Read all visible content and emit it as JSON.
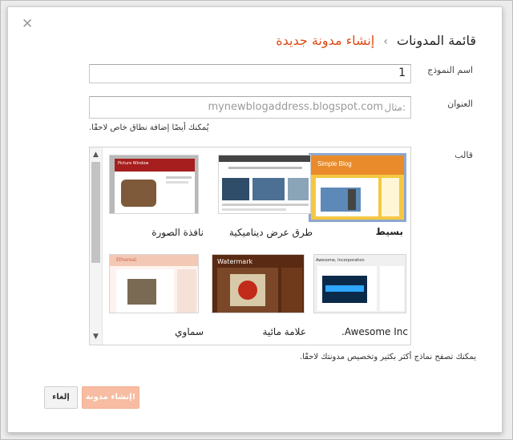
{
  "dialog": {
    "close_glyph": "✕",
    "breadcrumb": {
      "parent": "قائمة المدونات",
      "separator": "›",
      "current": "إنشاء مدونة جديدة"
    }
  },
  "form": {
    "title_label": "اسم النموذج",
    "title_value": "1",
    "address_label": "العنوان",
    "address_prefix": "مثال:",
    "address_placeholder": "mynewblogaddress.blogspot.com",
    "address_hint": "يُمكنك أيضًا إضافة نطاق خاص لاحقًا.",
    "template_label": "قالب"
  },
  "templates": [
    {
      "name": "بسيط",
      "selected": true
    },
    {
      "name": "طرق عرض ديناميكية",
      "selected": false
    },
    {
      "name": "نافذة الصورة",
      "selected": false
    },
    {
      "name": "Awesome Inc.",
      "selected": false
    },
    {
      "name": "علامة مائية",
      "selected": false
    },
    {
      "name": "سماوي",
      "selected": false
    }
  ],
  "thumbnails": {
    "simple_title": "Simple Blog",
    "picture_window_title": "Picture Window",
    "watermark_title": "Watermark",
    "awesome_title": "Awesome, Incorporation",
    "ethereal_title": "Ethereal"
  },
  "template_hint": "يمكنك تصفح نماذج أكثر بكثير وتخصيص مدونتك لاحقًا.",
  "buttons": {
    "cancel": "إلغاء",
    "create": "إنشاء مدونة!"
  },
  "scrollbar": {
    "up_glyph": "▲",
    "down_glyph": "▼"
  },
  "colors": {
    "accent_orange": "#dd4b14",
    "selected_border": "#8ea7ce",
    "create_button": "#f7bca1"
  }
}
